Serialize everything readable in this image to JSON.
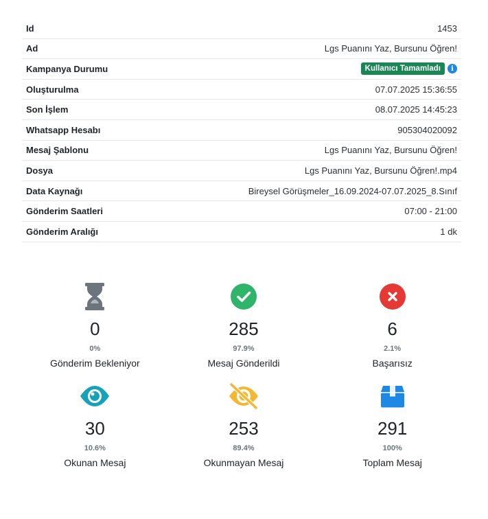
{
  "details": [
    {
      "label": "Id",
      "value": "1453"
    },
    {
      "label": "Ad",
      "value": "Lgs Puanını Yaz, Bursunu Öğren!"
    },
    {
      "label": "Kampanya Durumu",
      "badge": "Kullanıcı Tamamladı",
      "badge_color": "#198754"
    },
    {
      "label": "Oluşturulma",
      "value": "07.07.2025 15:36:55"
    },
    {
      "label": "Son İşlem",
      "value": "08.07.2025 14:45:23"
    },
    {
      "label": "Whatsapp Hesabı",
      "value": "905304020092"
    },
    {
      "label": "Mesaj Şablonu",
      "value": "Lgs Puanını Yaz, Bursunu Öğren!"
    },
    {
      "label": "Dosya",
      "value": "Lgs Puanını Yaz, Bursunu Öğren!.mp4"
    },
    {
      "label": "Data Kaynağı",
      "value": "Bireysel Görüşmeler_16.09.2024-07.07.2025_8.Sınıf"
    },
    {
      "label": "Gönderim Saatleri",
      "value": "07:00 - 21:00"
    },
    {
      "label": "Gönderim Aralığı",
      "value": "1 dk"
    }
  ],
  "stats": [
    {
      "icon": "hourglass-icon",
      "color": "#6c757d",
      "count": "0",
      "percent": "0%",
      "label": "Gönderim Bekleniyor"
    },
    {
      "icon": "check-circle-icon",
      "color": "#2fb56a",
      "count": "285",
      "percent": "97.9%",
      "label": "Mesaj Gönderildi"
    },
    {
      "icon": "x-circle-icon",
      "color": "#e53935",
      "count": "6",
      "percent": "2.1%",
      "label": "Başarısız"
    },
    {
      "icon": "eye-icon",
      "color": "#17a2b8",
      "count": "30",
      "percent": "10.6%",
      "label": "Okunan Mesaj"
    },
    {
      "icon": "eye-slash-icon",
      "color": "#f5b731",
      "count": "253",
      "percent": "89.4%",
      "label": "Okunmayan Mesaj"
    },
    {
      "icon": "box-icon",
      "color": "#1e88e5",
      "count": "291",
      "percent": "100%",
      "label": "Toplam Mesaj"
    }
  ]
}
